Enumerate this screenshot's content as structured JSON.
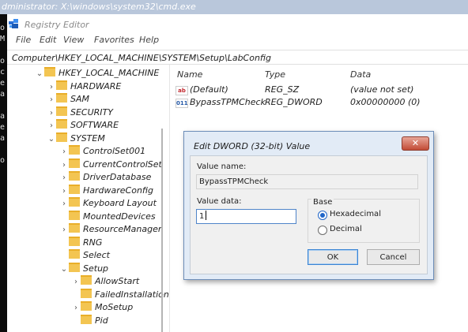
{
  "cmd": {
    "title": "dministrator: X:\\windows\\system32\\cmd.exe",
    "left_chars": [
      "o",
      "M",
      "",
      "o",
      "c",
      "e",
      "a",
      "",
      "a",
      "e",
      "a",
      "",
      "o"
    ]
  },
  "regedit": {
    "title": "Registry Editor",
    "menu": [
      "File",
      "Edit",
      "View",
      "Favorites",
      "Help"
    ],
    "address": "Computer\\HKEY_LOCAL_MACHINE\\SYSTEM\\Setup\\LabConfig",
    "tree": [
      {
        "label": "HKEY_LOCAL_MACHINE",
        "chevron": "⌄"
      },
      {
        "label": "HARDWARE",
        "chevron": "›"
      },
      {
        "label": "SAM",
        "chevron": "›"
      },
      {
        "label": "SECURITY",
        "chevron": "›"
      },
      {
        "label": "SOFTWARE",
        "chevron": "›"
      },
      {
        "label": "SYSTEM",
        "chevron": "⌄"
      },
      {
        "label": "ControlSet001",
        "chevron": "›"
      },
      {
        "label": "CurrentControlSet",
        "chevron": "›"
      },
      {
        "label": "DriverDatabase",
        "chevron": "›"
      },
      {
        "label": "HardwareConfig",
        "chevron": "›"
      },
      {
        "label": "Keyboard Layout",
        "chevron": "›"
      },
      {
        "label": "MountedDevices",
        "chevron": ""
      },
      {
        "label": "ResourceManager",
        "chevron": "›"
      },
      {
        "label": "RNG",
        "chevron": ""
      },
      {
        "label": "Select",
        "chevron": ""
      },
      {
        "label": "Setup",
        "chevron": "⌄"
      },
      {
        "label": "AllowStart",
        "chevron": "›"
      },
      {
        "label": "FailedInstallation",
        "chevron": ""
      },
      {
        "label": "MoSetup",
        "chevron": "›"
      },
      {
        "label": "Pid",
        "chevron": ""
      }
    ],
    "columns": {
      "name": "Name",
      "type": "Type",
      "data": "Data"
    },
    "values": [
      {
        "icon": "ab",
        "name": "(Default)",
        "type": "REG_SZ",
        "data": "(value not set)"
      },
      {
        "icon": "011",
        "name": "BypassTPMCheck",
        "type": "REG_DWORD",
        "data": "0x00000000 (0)"
      }
    ]
  },
  "dialog": {
    "title": "Edit DWORD (32-bit) Value",
    "close_glyph": "✕",
    "value_name_label": "Value name:",
    "value_name": "BypassTPMCheck",
    "value_data_label": "Value data:",
    "value_data": "1",
    "base_label": "Base",
    "base_options": [
      "Hexadecimal",
      "Decimal"
    ],
    "base_selected": "Hexadecimal",
    "ok_label": "OK",
    "cancel_label": "Cancel"
  }
}
